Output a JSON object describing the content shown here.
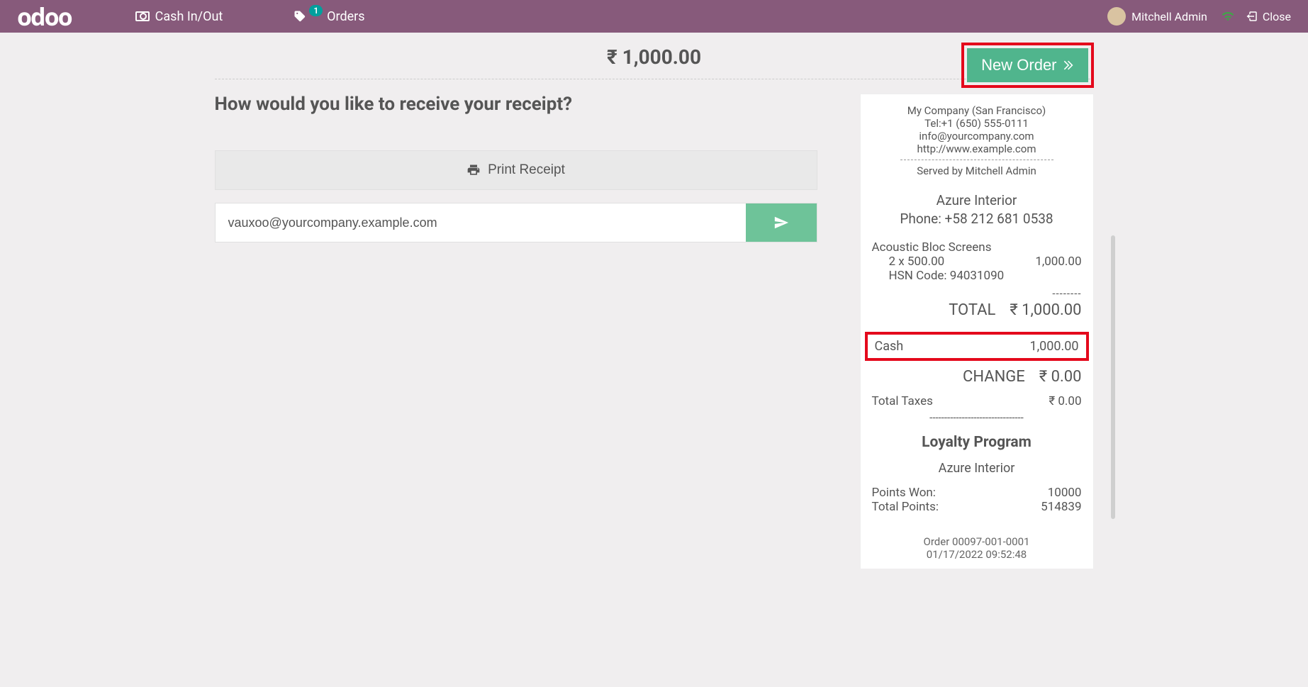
{
  "topbar": {
    "logo": "odoo",
    "cash_label": "Cash In/Out",
    "orders_label": "Orders",
    "orders_badge": "1",
    "user_name": "Mitchell Admin",
    "close_label": "Close"
  },
  "main": {
    "total_amount": "₹ 1,000.00",
    "new_order_label": "New Order",
    "question": "How would you like to receive your receipt?",
    "print_label": "Print Receipt",
    "email_value": "vauxoo@yourcompany.example.com"
  },
  "receipt": {
    "company": "My Company (San Francisco)",
    "tel": "Tel:+1 (650) 555-0111",
    "email": "info@yourcompany.com",
    "web": "http://www.example.com",
    "served": "Served by Mitchell Admin",
    "customer_name": "Azure Interior",
    "customer_phone": "Phone: +58 212 681 0538",
    "item_name": "Acoustic Bloc Screens",
    "item_qty": "2 x 500.00",
    "item_amount": "1,000.00",
    "item_hsn": "HSN Code: 94031090",
    "total_label": "TOTAL",
    "total_value": "₹ 1,000.00",
    "cash_label": "Cash",
    "cash_value": "1,000.00",
    "change_label": "CHANGE",
    "change_value": "₹ 0.00",
    "taxes_label": "Total Taxes",
    "taxes_value": "₹ 0.00",
    "loyalty_heading": "Loyalty Program",
    "loyalty_customer": "Azure Interior",
    "points_won_label": "Points Won:",
    "points_won_value": "10000",
    "total_points_label": "Total Points:",
    "total_points_value": "514839",
    "order_ref": "Order 00097-001-0001",
    "order_date": "01/17/2022 09:52:48"
  }
}
